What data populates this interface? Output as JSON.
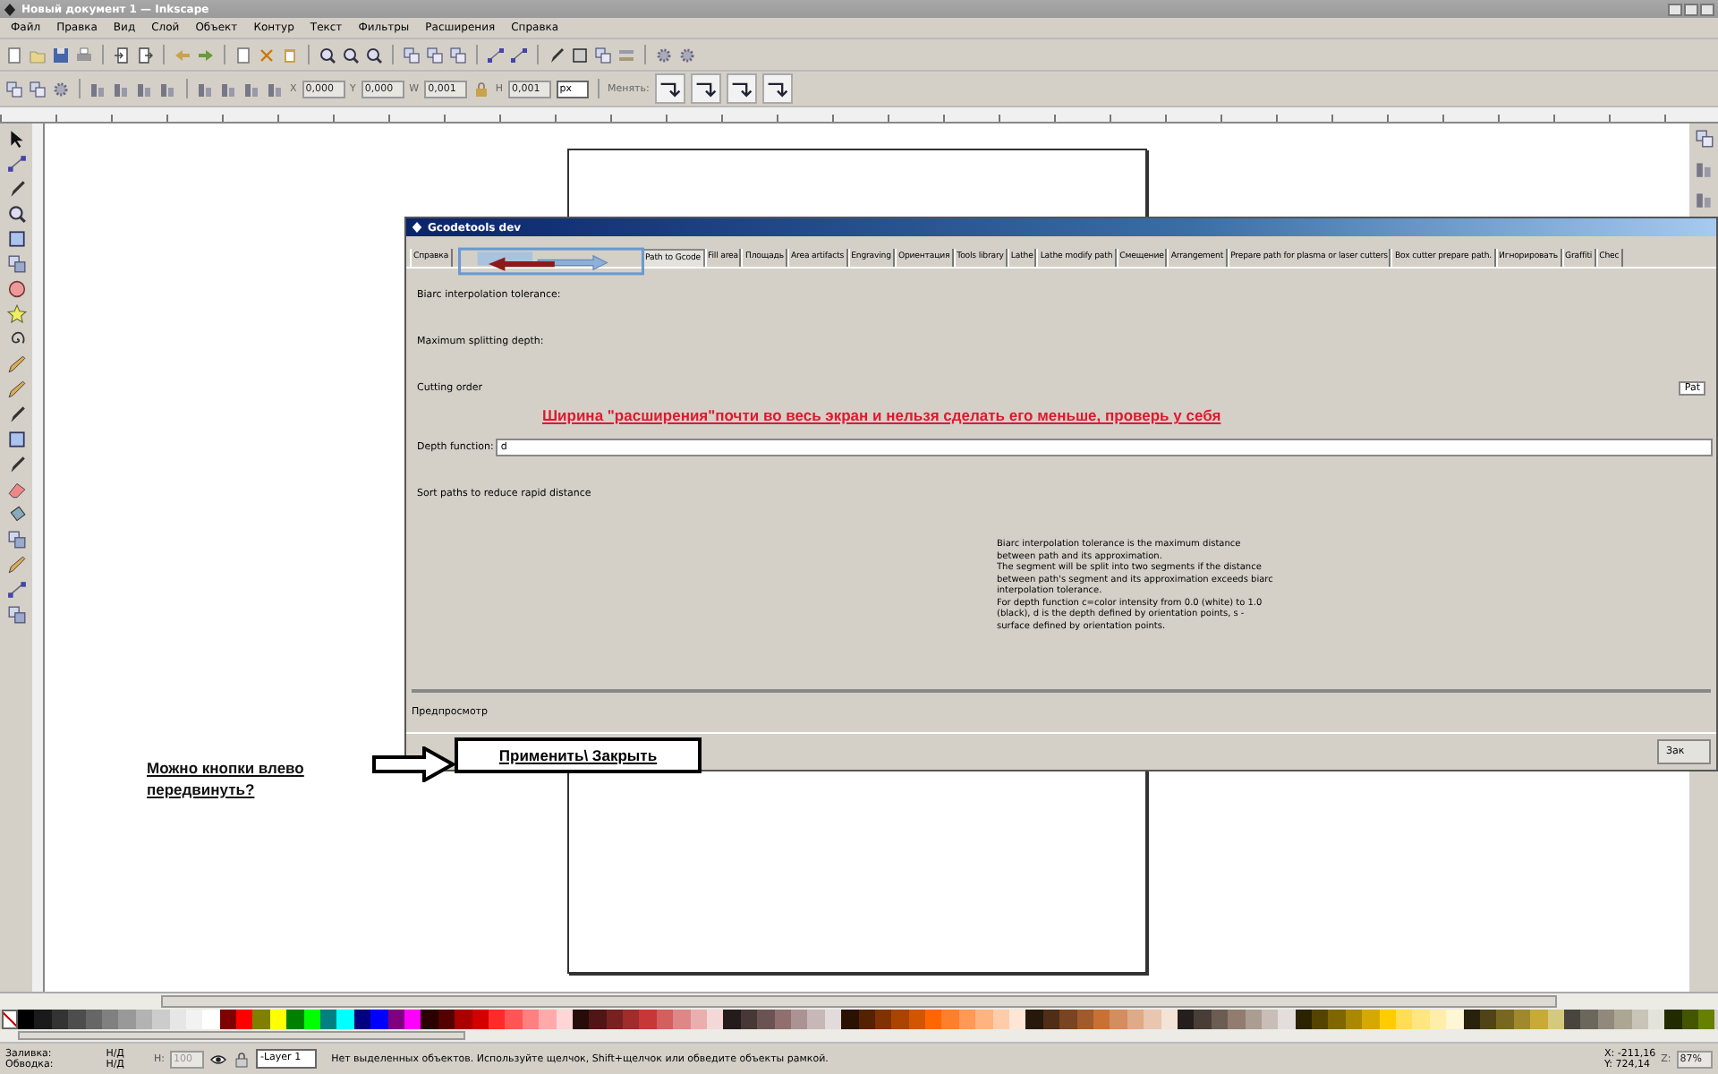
{
  "window": {
    "title": "Новый документ 1 — Inkscape"
  },
  "menu": [
    "Файл",
    "Правка",
    "Вид",
    "Слой",
    "Объект",
    "Контур",
    "Текст",
    "Фильтры",
    "Расширения",
    "Справка"
  ],
  "toolbar2": {
    "fields": [
      {
        "label": "X",
        "value": "0,000"
      },
      {
        "label": "Y",
        "value": "0,000"
      },
      {
        "label": "W",
        "value": "0,001"
      },
      {
        "label": "H",
        "value": "0,001"
      }
    ],
    "unit": "px",
    "transform_label": "Менять:"
  },
  "dialog": {
    "title": "Gcodetools dev",
    "tabs": [
      {
        "label": "Справка",
        "selected": false
      },
      {
        "label": "Path to Gcode",
        "selected": true
      },
      {
        "label": "Fill area",
        "selected": false
      },
      {
        "label": "Площадь",
        "selected": false
      },
      {
        "label": "Area artifacts",
        "selected": false
      },
      {
        "label": "Engraving",
        "selected": false
      },
      {
        "label": "Ориентация",
        "selected": false
      },
      {
        "label": "Tools library",
        "selected": false
      },
      {
        "label": "Lathe",
        "selected": false
      },
      {
        "label": "Lathe modify path",
        "selected": false
      },
      {
        "label": "Смещение",
        "selected": false
      },
      {
        "label": "Arrangement",
        "selected": false
      },
      {
        "label": "Prepare path for plasma or laser cutters",
        "selected": false
      },
      {
        "label": "Box cutter prepare path.",
        "selected": false
      },
      {
        "label": "Игнорировать",
        "selected": false
      },
      {
        "label": "Graffiti",
        "selected": false
      },
      {
        "label": "Chec",
        "selected": false
      }
    ],
    "params": [
      {
        "kind": "label",
        "label": "Biarc interpolation tolerance:"
      },
      {
        "kind": "label",
        "label": "Maximum splitting depth:"
      },
      {
        "kind": "select",
        "label": "Cutting order",
        "value": "Pat"
      },
      {
        "kind": "input",
        "label": "Depth function:",
        "value": "d"
      },
      {
        "kind": "label",
        "label": "Sort paths to reduce rapid distance"
      }
    ],
    "help": [
      "Biarc interpolation tolerance is the maximum distance between path and its approximation.",
      "The segment will be split into two segments if the distance between path's segment and its approximation exceeds biarc interpolation tolerance.",
      "For depth function c=color intensity from 0.0 (white) to 1.0 (black), d is the depth defined by orientation points, s - surface defined by orientation points."
    ],
    "preview_label": "Предпросмотр",
    "close_button": "Зак"
  },
  "annotations": {
    "width_note": "Ширина \"расширения\"почти во весь экран и нельзя сделать его меньше, проверь у себя",
    "buttons_note": "Можно кнопки влево передвинуть?",
    "buttons_box": "Применить\\ Закрыть"
  },
  "palette": [
    {
      "color": "#000000"
    },
    {
      "color": "#1a1a1a"
    },
    {
      "color": "#333333"
    },
    {
      "color": "#4d4d4d"
    },
    {
      "color": "#666666"
    },
    {
      "color": "#808080"
    },
    {
      "color": "#999999"
    },
    {
      "color": "#b3b3b3"
    },
    {
      "color": "#cccccc"
    },
    {
      "color": "#e6e6e6"
    },
    {
      "color": "#f2f2f2"
    },
    {
      "color": "#ffffff"
    },
    {
      "color": "#800000"
    },
    {
      "color": "#ff0000"
    },
    {
      "color": "#808000"
    },
    {
      "color": "#ffff00"
    },
    {
      "color": "#008000"
    },
    {
      "color": "#00ff00"
    },
    {
      "color": "#008080"
    },
    {
      "color": "#00ffff"
    },
    {
      "color": "#000080"
    },
    {
      "color": "#0000ff"
    },
    {
      "color": "#800080"
    },
    {
      "color": "#ff00ff"
    },
    {
      "color": "#2b0000"
    },
    {
      "color": "#550000"
    },
    {
      "color": "#aa0000"
    },
    {
      "color": "#d40000"
    },
    {
      "color": "#ff2a2a"
    },
    {
      "color": "#ff5555"
    },
    {
      "color": "#ff8080"
    },
    {
      "color": "#ffaaaa"
    },
    {
      "color": "#ffd5d5"
    },
    {
      "color": "#280b0b"
    },
    {
      "color": "#501616"
    },
    {
      "color": "#782121"
    },
    {
      "color": "#a02c2c"
    },
    {
      "color": "#c83737"
    },
    {
      "color": "#d35f5f"
    },
    {
      "color": "#de8787"
    },
    {
      "color": "#e9afaf"
    },
    {
      "color": "#f4d7d7"
    },
    {
      "color": "#241c1c"
    },
    {
      "color": "#483737"
    },
    {
      "color": "#6c5353"
    },
    {
      "color": "#916f6f"
    },
    {
      "color": "#ac9393"
    },
    {
      "color": "#c8b7b7"
    },
    {
      "color": "#e3dbdb"
    },
    {
      "color": "#2b1100"
    },
    {
      "color": "#552200"
    },
    {
      "color": "#803300"
    },
    {
      "color": "#aa4400"
    },
    {
      "color": "#d45500"
    },
    {
      "color": "#ff6600"
    },
    {
      "color": "#ff7f2a"
    },
    {
      "color": "#ff9955"
    },
    {
      "color": "#ffb380"
    },
    {
      "color": "#ffccaa"
    },
    {
      "color": "#ffe6d5"
    },
    {
      "color": "#28170b"
    },
    {
      "color": "#502d16"
    },
    {
      "color": "#784421"
    },
    {
      "color": "#a05a2c"
    },
    {
      "color": "#c87137"
    },
    {
      "color": "#d38d5f"
    },
    {
      "color": "#deaa87"
    },
    {
      "color": "#e9c6af"
    },
    {
      "color": "#f4e3d7"
    },
    {
      "color": "#241f1c"
    },
    {
      "color": "#483e37"
    },
    {
      "color": "#6c5d53"
    },
    {
      "color": "#917c6f"
    },
    {
      "color": "#ac9d93"
    },
    {
      "color": "#c8beb7"
    },
    {
      "color": "#e3dedb"
    },
    {
      "color": "#2b2200"
    },
    {
      "color": "#554400"
    },
    {
      "color": "#806600"
    },
    {
      "color": "#aa8800"
    },
    {
      "color": "#d4aa00"
    },
    {
      "color": "#ffcc00"
    },
    {
      "color": "#ffdd55"
    },
    {
      "color": "#ffe680"
    },
    {
      "color": "#ffeeaa"
    },
    {
      "color": "#fff6d5"
    },
    {
      "color": "#28220b"
    },
    {
      "color": "#504416"
    },
    {
      "color": "#786721"
    },
    {
      "color": "#a0892c"
    },
    {
      "color": "#c8ab37"
    },
    {
      "color": "#d4c97f"
    },
    {
      "color": "#48453e"
    },
    {
      "color": "#6c675d"
    },
    {
      "color": "#918a7c"
    },
    {
      "color": "#aca793"
    },
    {
      "color": "#c8c4b7"
    },
    {
      "color": "#e3e2db"
    },
    {
      "color": "#222b00"
    },
    {
      "color": "#445500"
    },
    {
      "color": "#668000"
    }
  ],
  "status": {
    "fill_label": "Заливка:",
    "fill_value": "Н/Д",
    "stroke_label": "Обводка:",
    "stroke_value": "Н/Д",
    "opacity_label": "H:",
    "opacity_value": "100",
    "layer": "-Layer 1",
    "message": "Нет выделенных объектов. Используйте щелчок, Shift+щелчок или обведите объекты рамкой.",
    "x": "X: -211,16",
    "y": "Y: 724,14",
    "zoom_label": "Z:",
    "zoom": "87%"
  }
}
